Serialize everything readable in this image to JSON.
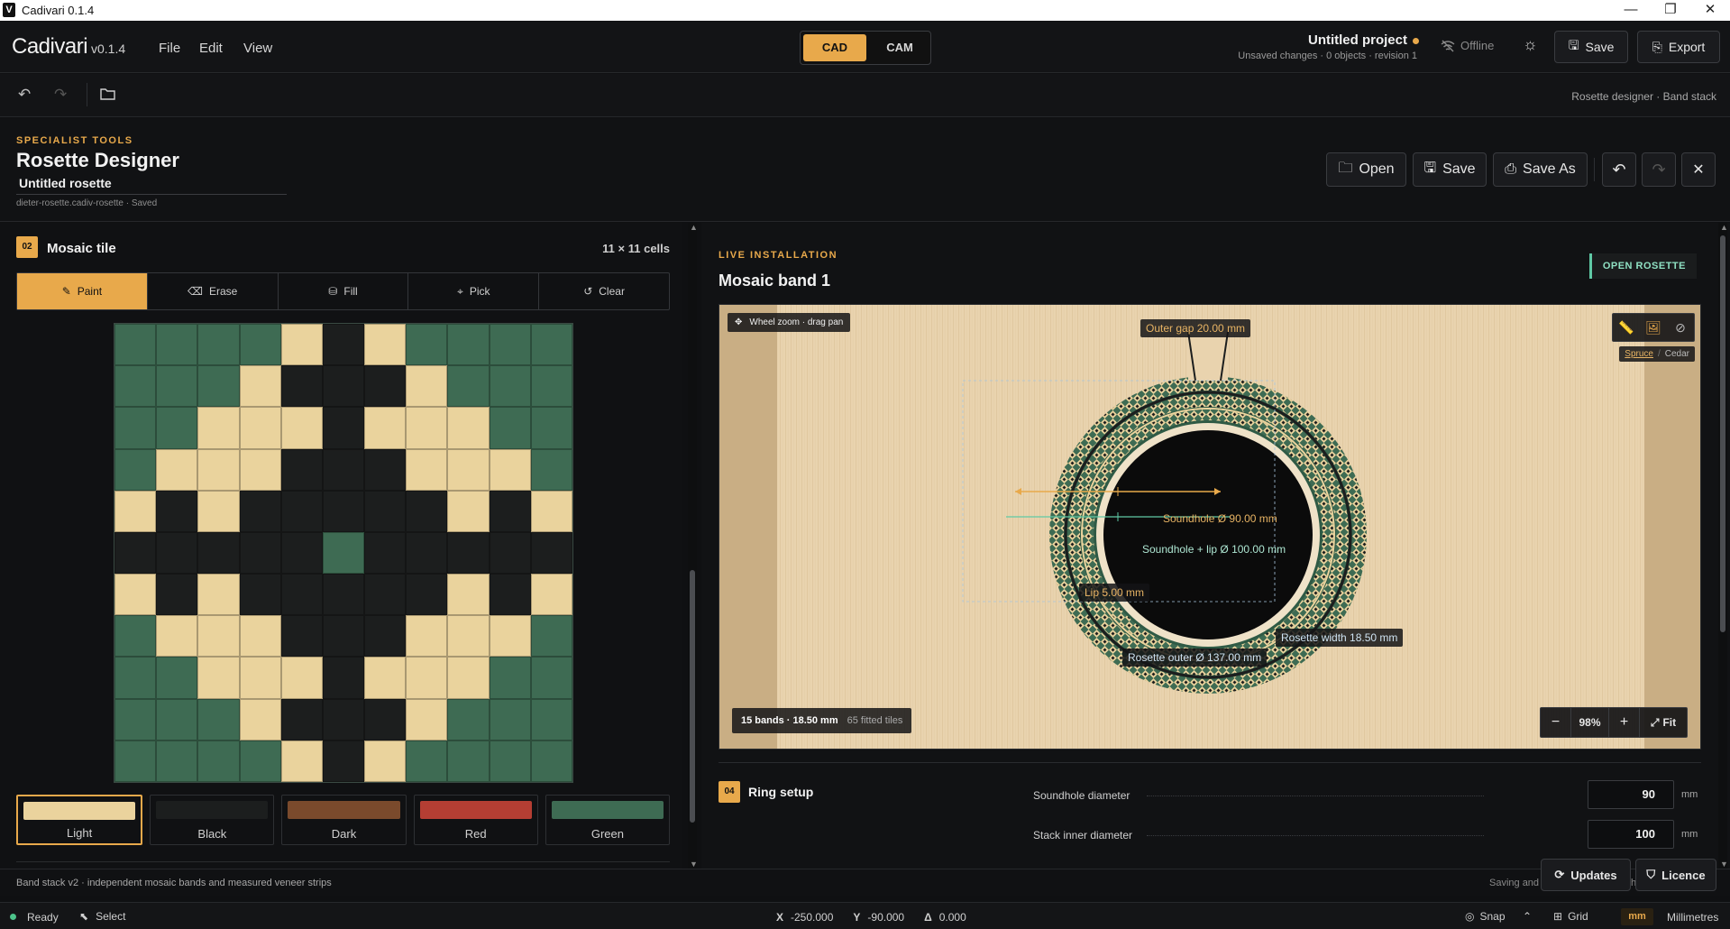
{
  "window": {
    "title": "Cadivari 0.1.4",
    "logo_letter": "V"
  },
  "app": {
    "brand": "Cadivari",
    "version": "v0.1.4",
    "menu": [
      "File",
      "Edit",
      "View"
    ],
    "modes": {
      "active": "CAD",
      "inactive": "CAM"
    },
    "project_title": "Untitled project",
    "project_status": "Unsaved changes · 0 objects · revision 1",
    "offline": "Offline",
    "save": "Save",
    "export": "Export"
  },
  "toolbar": {
    "crumbs": "Rosette designer · Band stack"
  },
  "designer": {
    "kicker": "SPECIALIST TOOLS",
    "title": "Rosette Designer",
    "name_value": "Untitled rosette",
    "file_status": "dieter-rosette.cadiv-rosette · Saved",
    "actions": {
      "open": "Open",
      "save": "Save",
      "save_as": "Save As"
    }
  },
  "mosaic": {
    "number": "02",
    "title": "Mosaic tile",
    "size": "11 × 11 cells",
    "tools": [
      "Paint",
      "Erase",
      "Fill",
      "Pick",
      "Clear"
    ],
    "cells": [
      [
        0,
        0,
        0,
        0,
        1,
        2,
        1,
        0,
        0,
        0,
        0
      ],
      [
        0,
        0,
        0,
        1,
        2,
        2,
        2,
        1,
        0,
        0,
        0
      ],
      [
        0,
        0,
        1,
        1,
        1,
        2,
        1,
        1,
        1,
        0,
        0
      ],
      [
        0,
        1,
        1,
        1,
        2,
        2,
        2,
        1,
        1,
        1,
        0
      ],
      [
        1,
        2,
        1,
        2,
        2,
        2,
        2,
        2,
        1,
        2,
        1
      ],
      [
        2,
        2,
        2,
        2,
        2,
        0,
        2,
        2,
        2,
        2,
        2
      ],
      [
        1,
        2,
        1,
        2,
        2,
        2,
        2,
        2,
        1,
        2,
        1
      ],
      [
        0,
        1,
        1,
        1,
        2,
        2,
        2,
        1,
        1,
        1,
        0
      ],
      [
        0,
        0,
        1,
        1,
        1,
        2,
        1,
        1,
        1,
        0,
        0
      ],
      [
        0,
        0,
        0,
        1,
        2,
        2,
        2,
        1,
        0,
        0,
        0
      ],
      [
        0,
        0,
        0,
        0,
        1,
        2,
        1,
        0,
        0,
        0,
        0
      ]
    ],
    "palette": [
      {
        "name": "Light",
        "color": "#ead39d"
      },
      {
        "name": "Black",
        "color": "#1c1e1e"
      },
      {
        "name": "Dark",
        "color": "#7a4a2c"
      },
      {
        "name": "Red",
        "color": "#b53e33"
      },
      {
        "name": "Green",
        "color": "#3e6b53"
      }
    ]
  },
  "preview": {
    "kicker": "LIVE INSTALLATION",
    "title": "Mosaic band 1",
    "open_btn": "OPEN ROSETTE",
    "hint": "Wheel zoom · drag pan",
    "wood": {
      "spruce": "Spruce",
      "sep": "/",
      "cedar": "Cedar"
    },
    "labels": {
      "outer_gap": "Outer gap 20.00 mm",
      "soundhole": "Soundhole Ø 90.00 mm",
      "soundhole_lip": "Soundhole + lip Ø 100.00 mm",
      "lip": "Lip 5.00 mm",
      "width": "Rosette width 18.50 mm",
      "outer": "Rosette outer Ø 137.00 mm"
    },
    "summary_strong": "15 bands · 18.50 mm",
    "summary": "65 fitted tiles",
    "zoom": "98%",
    "fit": "Fit"
  },
  "ring": {
    "number": "04",
    "title": "Ring setup",
    "fields": [
      {
        "label": "Soundhole diameter",
        "value": "90",
        "unit": "mm"
      },
      {
        "label": "Stack inner diameter",
        "value": "100",
        "unit": "mm"
      }
    ]
  },
  "footer": {
    "note": "Band stack v2 · independent mosaic bands and measured veneer strips",
    "saving": "Saving and",
    "updates": "Updates",
    "licence": "Licence",
    "tail": "he"
  },
  "status": {
    "ready": "Ready",
    "tool": "Select",
    "x": "-250.000",
    "y": "-90.000",
    "delta": "0.000",
    "x_label": "X",
    "y_label": "Y",
    "delta_label": "Δ",
    "snap": "Snap",
    "grid": "Grid",
    "unit_badge": "mm",
    "unit": "Millimetres"
  }
}
